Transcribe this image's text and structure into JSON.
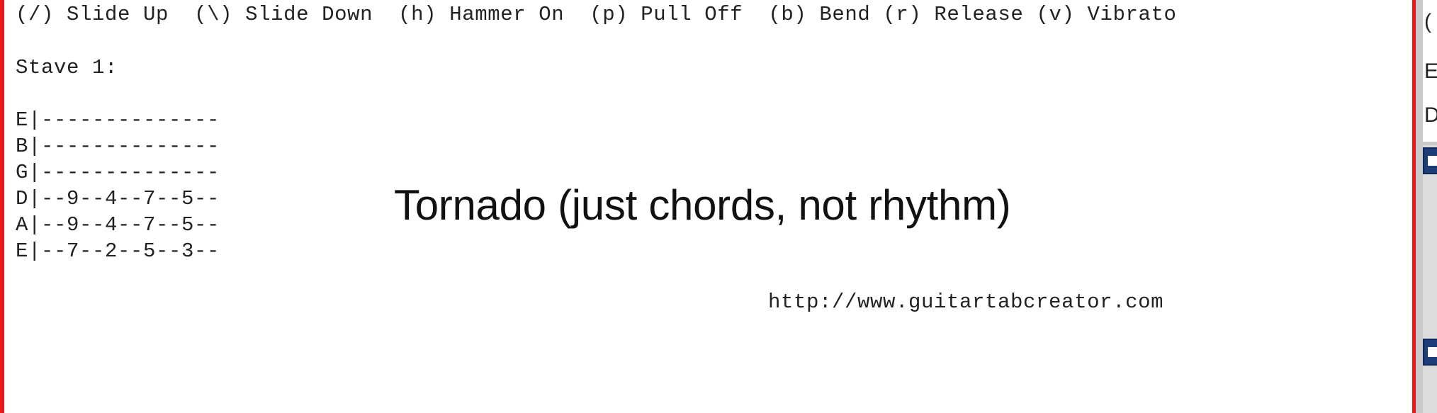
{
  "legend": {
    "items": [
      {
        "symbol": "(/)",
        "label": "Slide Up"
      },
      {
        "symbol": "(\\)",
        "label": "Slide Down"
      },
      {
        "symbol": "(h)",
        "label": "Hammer On"
      },
      {
        "symbol": "(p)",
        "label": "Pull Off"
      },
      {
        "symbol": "(b)",
        "label": "Bend"
      },
      {
        "symbol": "(r)",
        "label": "Release"
      },
      {
        "symbol": "(v)",
        "label": "Vibrato"
      }
    ]
  },
  "stave_label": "Stave 1:",
  "tab": {
    "lines": [
      {
        "string": "E",
        "content": "|--------------"
      },
      {
        "string": "B",
        "content": "|--------------"
      },
      {
        "string": "G",
        "content": "|--------------"
      },
      {
        "string": "D",
        "content": "|--9--4--7--5--"
      },
      {
        "string": "A",
        "content": "|--9--4--7--5--"
      },
      {
        "string": "E",
        "content": "|--7--2--5--3--"
      }
    ]
  },
  "title": "Tornado (just chords, not rhythm)",
  "url": "http://www.guitartabcreator.com",
  "colors": {
    "border": "#e8191b",
    "panel": "#c9c9c9",
    "checkbox": "#1c3d77"
  },
  "side_panel": {
    "peek_chars": [
      "(",
      "E",
      "D"
    ]
  }
}
